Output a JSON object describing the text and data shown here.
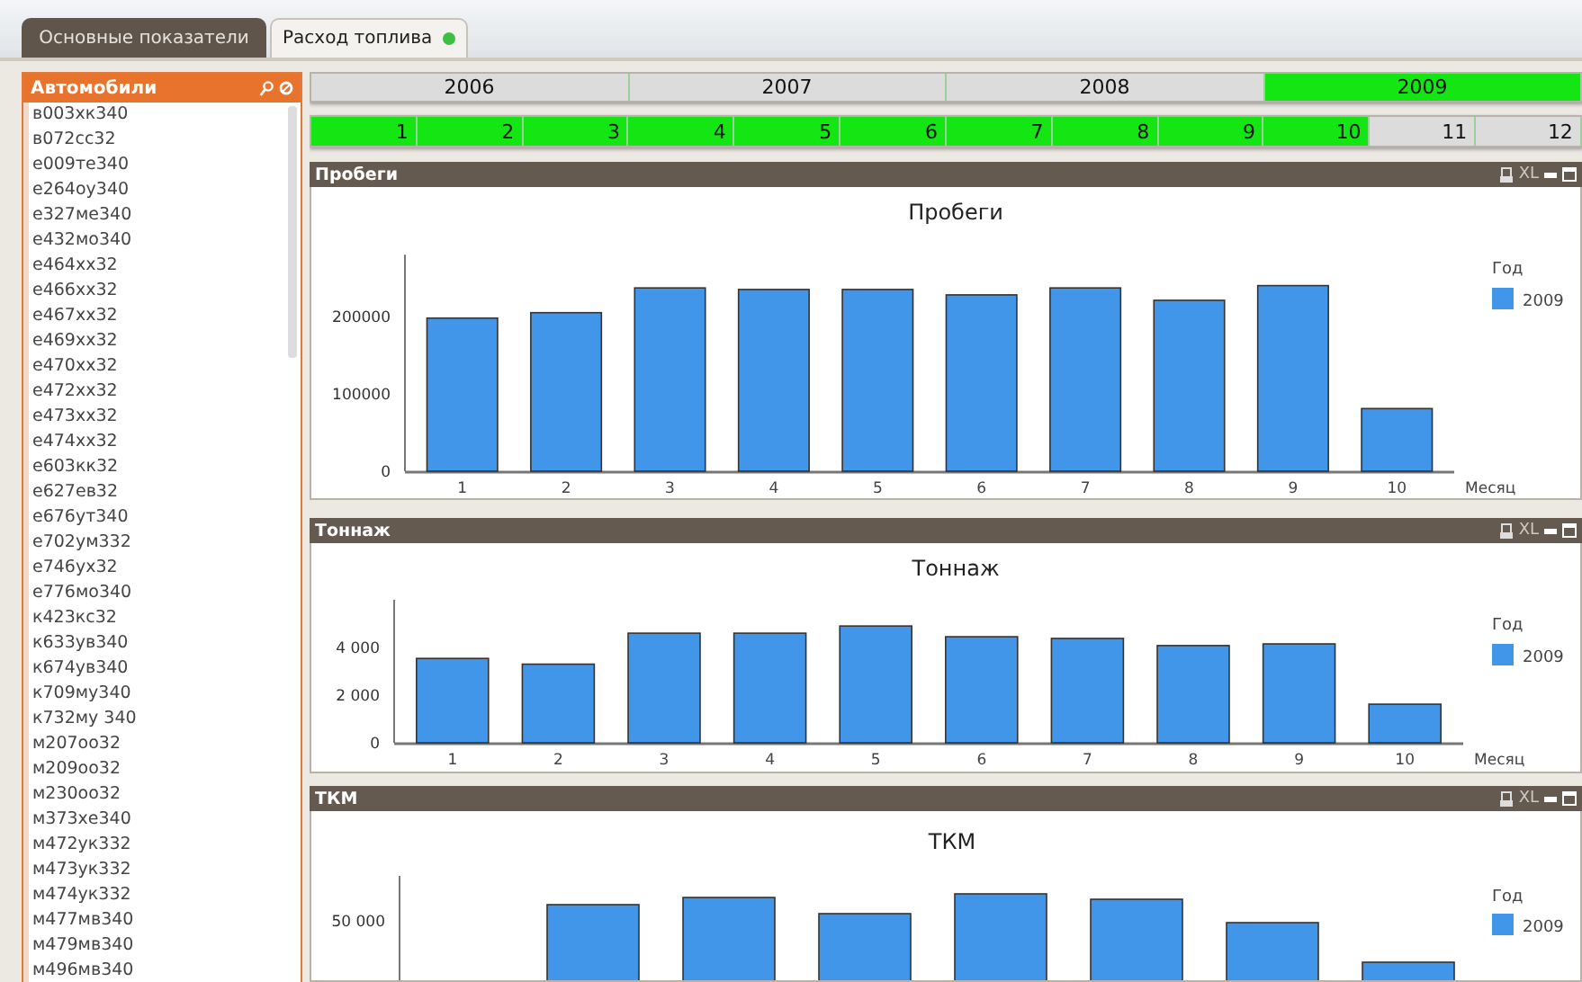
{
  "tabs": [
    {
      "label": "Основные показатели",
      "selected": false
    },
    {
      "label": "Расход топлива",
      "selected": true
    }
  ],
  "sidebar": {
    "title": "Автомобили",
    "items": [
      "в003хк340",
      "в072сс32",
      "е009те340",
      "е264оу340",
      "е327ме340",
      "е432мо340",
      "е464хх32",
      "е466хх32",
      "е467хх32",
      "е469хх32",
      "е470хх32",
      "е472хх32",
      "е473хх32",
      "е474хх32",
      "е603кк32",
      "е627ев32",
      "е676ут340",
      "е702ум332",
      "е746ух32",
      "е776мо340",
      "к423кс32",
      "к633ув340",
      "к674ув340",
      "к709му340",
      "к732му 340",
      "м207оо32",
      "м209оо32",
      "м230оо32",
      "м373хе340",
      "м472ук332",
      "м473ук332",
      "м474ук332",
      "м477мв340",
      "м479мв340",
      "м496мв340"
    ]
  },
  "years": [
    {
      "label": "2006",
      "selected": false
    },
    {
      "label": "2007",
      "selected": false
    },
    {
      "label": "2008",
      "selected": false
    },
    {
      "label": "2009",
      "selected": true
    }
  ],
  "months": [
    {
      "label": "1",
      "selected": true
    },
    {
      "label": "2",
      "selected": true
    },
    {
      "label": "3",
      "selected": true
    },
    {
      "label": "4",
      "selected": true
    },
    {
      "label": "5",
      "selected": true
    },
    {
      "label": "6",
      "selected": true
    },
    {
      "label": "7",
      "selected": true
    },
    {
      "label": "8",
      "selected": true
    },
    {
      "label": "9",
      "selected": true
    },
    {
      "label": "10",
      "selected": true
    },
    {
      "label": "11",
      "selected": false
    },
    {
      "label": "12",
      "selected": false
    }
  ],
  "panels": [
    {
      "title": "Пробеги",
      "xl": "XL",
      "legend_title": "Год",
      "chart_data": {
        "type": "bar",
        "title": "Пробеги",
        "xlabel": "Месяц",
        "categories": [
          "1",
          "2",
          "3",
          "4",
          "5",
          "6",
          "7",
          "8",
          "9",
          "10"
        ],
        "ylim": [
          0,
          280000
        ],
        "yticks": [
          {
            "value": 0,
            "label": "0"
          },
          {
            "value": 100000,
            "label": "100000"
          },
          {
            "value": 200000,
            "label": "200000"
          }
        ],
        "series": [
          {
            "name": "2009",
            "color": "#4196ea",
            "values": [
              198000,
              205000,
              237000,
              235000,
              235000,
              228000,
              237000,
              221000,
              240000,
              81000
            ]
          }
        ]
      }
    },
    {
      "title": "Тоннаж",
      "xl": "XL",
      "legend_title": "Год",
      "chart_data": {
        "type": "bar",
        "title": "Тоннаж",
        "xlabel": "Месяц",
        "categories": [
          "1",
          "2",
          "3",
          "4",
          "5",
          "6",
          "7",
          "8",
          "9",
          "10"
        ],
        "ylim": [
          0,
          6000
        ],
        "yticks": [
          {
            "value": 0,
            "label": "0"
          },
          {
            "value": 2000,
            "label": "2 000"
          },
          {
            "value": 4000,
            "label": "4 000"
          }
        ],
        "series": [
          {
            "name": "2009",
            "color": "#4196ea",
            "values": [
              3540,
              3300,
              4600,
              4600,
              4900,
              4450,
              4380,
              4080,
              4150,
              1620
            ]
          }
        ]
      }
    },
    {
      "title": "ТКМ",
      "xl": "XL",
      "legend_title": "Год",
      "chart_title": "ТКМ",
      "tick": "50 000",
      "legend_item": "2009",
      "color": "#4196ea"
    }
  ]
}
